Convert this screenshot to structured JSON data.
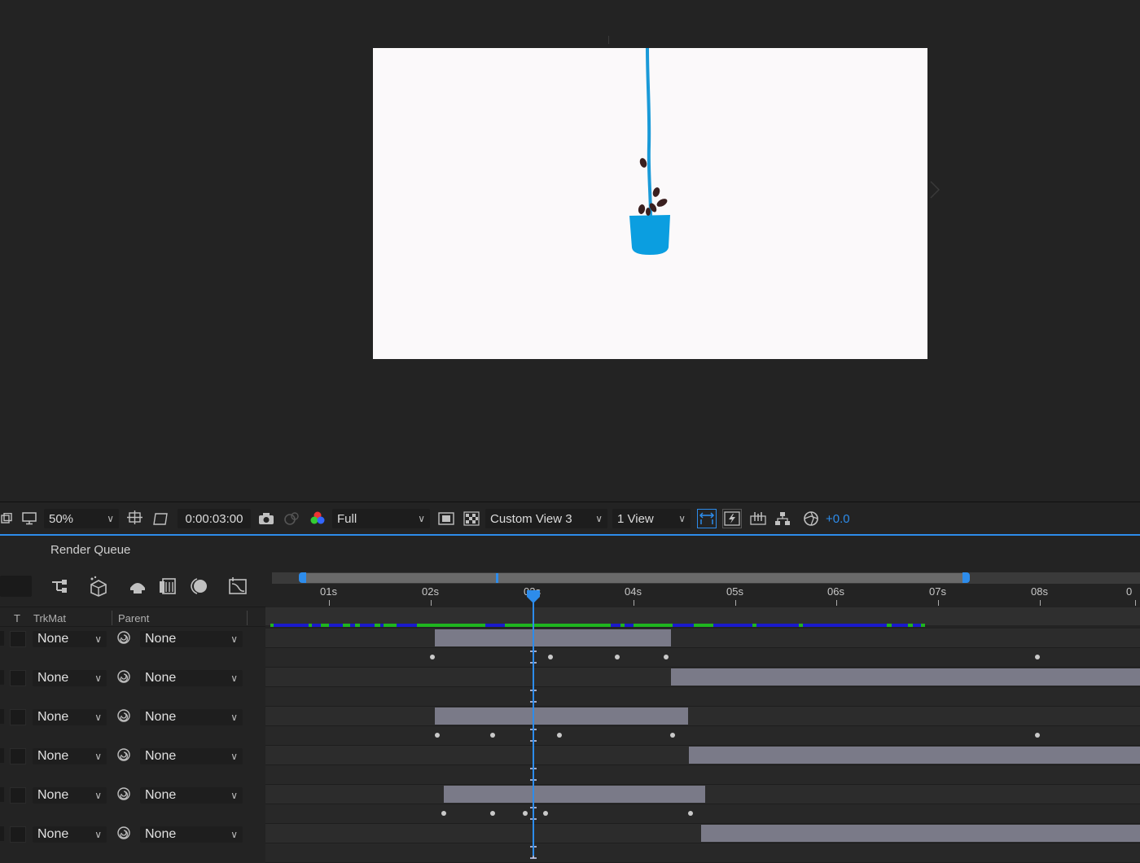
{
  "viewer": {
    "canvas_bg": "#fbf9fa",
    "cup_color": "#0b9ee0",
    "stream_color": "#1a9ad8",
    "bean_color": "#3a1f1f"
  },
  "toolbar": {
    "zoom": "50%",
    "timecode": "0:00:03:00",
    "resolution": "Full",
    "view": "Custom View 3",
    "layout": "1 View",
    "exposure": "+0.0"
  },
  "panel": {
    "title": "Render Queue"
  },
  "columns": {
    "t": "T",
    "trkmat": "TrkMat",
    "parent": "Parent"
  },
  "ruler": {
    "labels": [
      "01s",
      "02s",
      "03s",
      "04s",
      "05s",
      "06s",
      "07s",
      "08s",
      "0"
    ]
  },
  "layers": [
    {
      "trkmat": "None",
      "parent": "None"
    },
    {
      "trkmat": "None",
      "parent": "None"
    },
    {
      "trkmat": "None",
      "parent": "None"
    },
    {
      "trkmat": "None",
      "parent": "None"
    },
    {
      "trkmat": "None",
      "parent": "None"
    },
    {
      "trkmat": "None",
      "parent": "None"
    }
  ],
  "colors": {
    "accent": "#2d8ceb",
    "layer_bar": "#7a7a88",
    "render_green": "#1fb51f",
    "render_blue": "#1a1acc"
  }
}
